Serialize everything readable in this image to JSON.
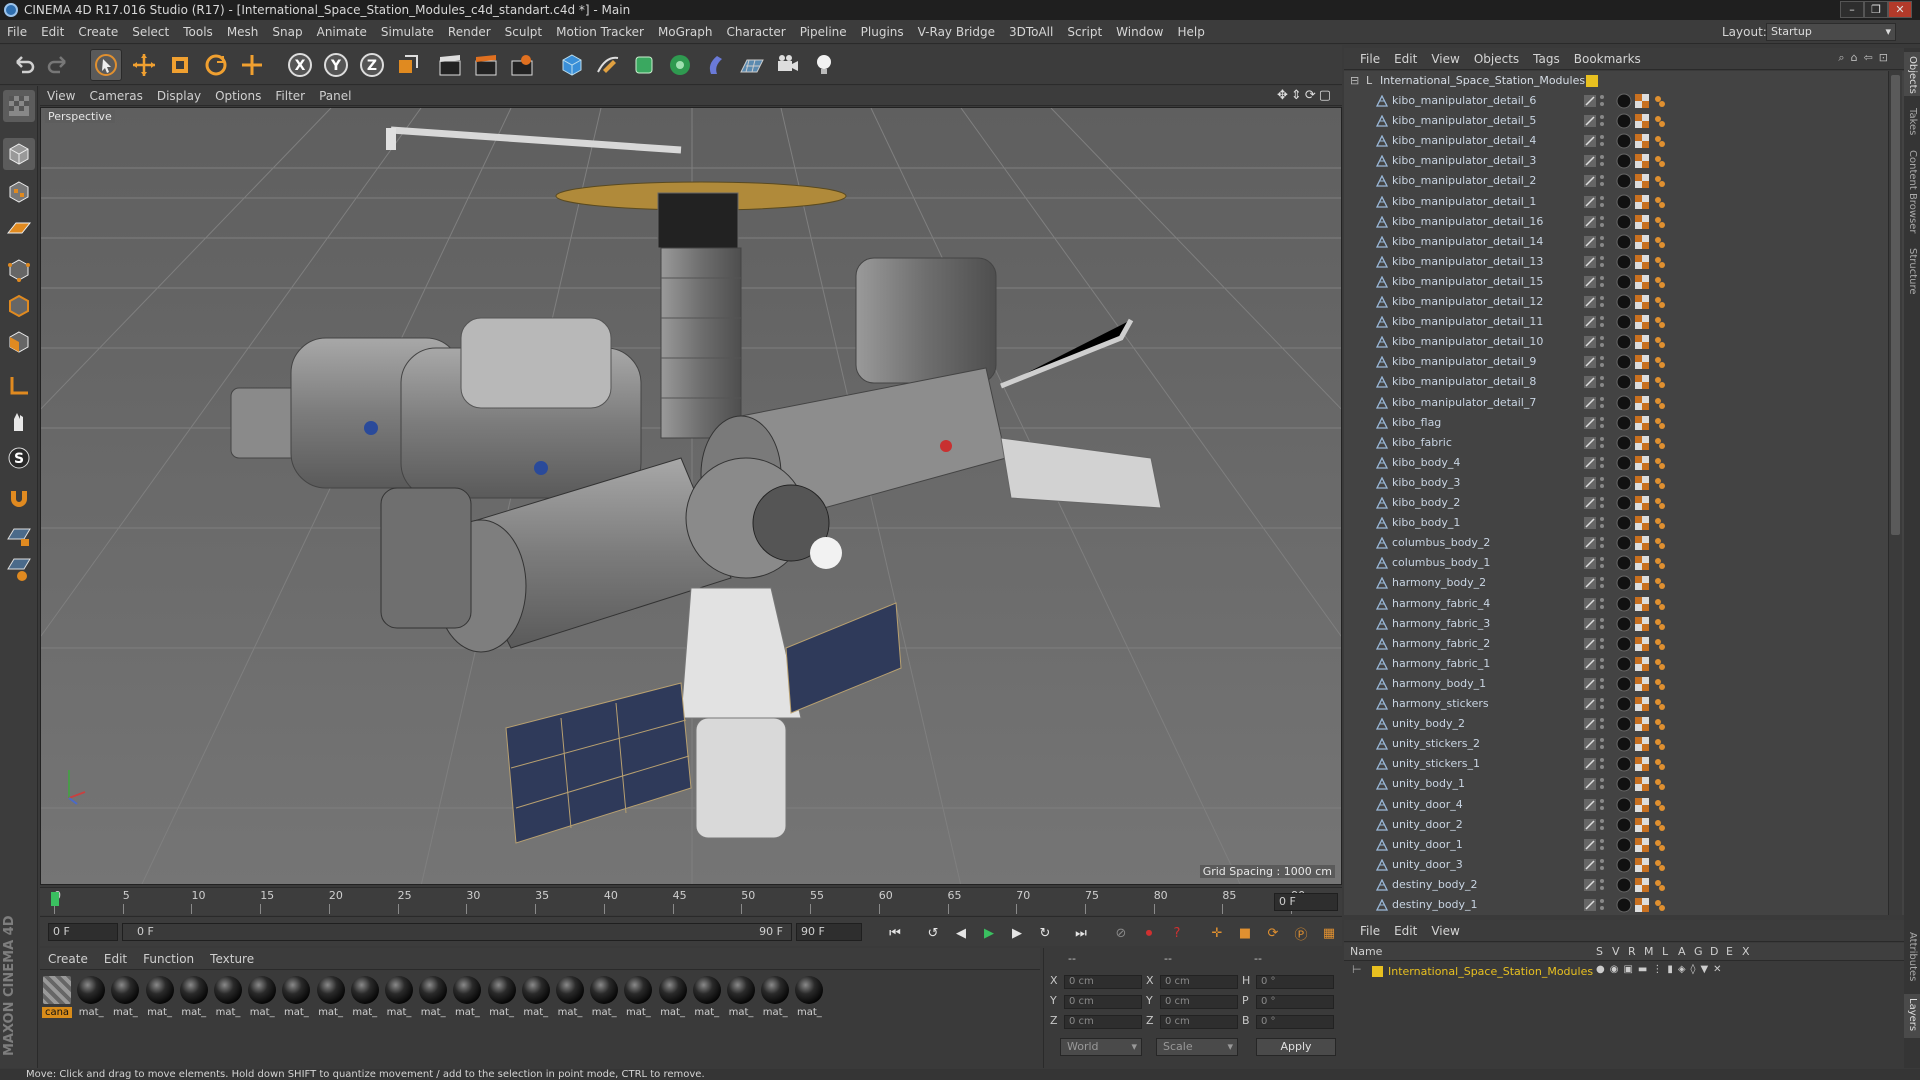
{
  "window": {
    "title": "CINEMA 4D R17.016 Studio (R17) - [International_Space_Station_Modules_c4d_standart.c4d *] - Main",
    "controls": [
      "–",
      "❐",
      "✕"
    ]
  },
  "menubar": {
    "items": [
      "File",
      "Edit",
      "Create",
      "Select",
      "Tools",
      "Mesh",
      "Snap",
      "Animate",
      "Simulate",
      "Render",
      "Sculpt",
      "Motion Tracker",
      "MoGraph",
      "Character",
      "Pipeline",
      "Plugins",
      "V-Ray Bridge",
      "3DToAll",
      "Script",
      "Window",
      "Help"
    ],
    "layout_label": "Layout:",
    "layout_value": "Startup"
  },
  "viewport": {
    "menu": [
      "View",
      "Cameras",
      "Display",
      "Options",
      "Filter",
      "Panel"
    ],
    "camera_label": "Perspective",
    "grid_spacing": "Grid Spacing : 1000 cm"
  },
  "timeline": {
    "ticks": [
      "0",
      "5",
      "10",
      "15",
      "20",
      "25",
      "30",
      "35",
      "40",
      "45",
      "50",
      "55",
      "60",
      "65",
      "70",
      "75",
      "80",
      "85",
      "90"
    ],
    "current_frame": "0 F",
    "start_field": "0 F",
    "range_start": "0 F",
    "range_end": "90 F",
    "end_field": "90 F"
  },
  "materials": {
    "menu": [
      "Create",
      "Edit",
      "Function",
      "Texture"
    ],
    "items": [
      "cana",
      "mat_",
      "mat_",
      "mat_",
      "mat_",
      "mat_",
      "mat_",
      "mat_",
      "mat_",
      "mat_",
      "mat_",
      "mat_",
      "mat_",
      "mat_",
      "mat_",
      "mat_",
      "mat_",
      "mat_",
      "mat_",
      "mat_",
      "mat_",
      "mat_",
      "mat_"
    ],
    "brand": "MAXON CINEMA 4D"
  },
  "coordinates": {
    "header_left": "--",
    "header_mid": "--",
    "header_right": "--",
    "rows": [
      {
        "a": "X",
        "av": "0 cm",
        "b": "X",
        "bv": "0 cm",
        "c": "H",
        "cv": "0 °"
      },
      {
        "a": "Y",
        "av": "0 cm",
        "b": "Y",
        "bv": "0 cm",
        "c": "P",
        "cv": "0 °"
      },
      {
        "a": "Z",
        "av": "0 cm",
        "b": "Z",
        "bv": "0 cm",
        "c": "B",
        "cv": "0 °"
      }
    ],
    "space": "World",
    "mode": "Scale",
    "apply": "Apply"
  },
  "object_manager": {
    "menu": [
      "File",
      "Edit",
      "View",
      "Objects",
      "Tags",
      "Bookmarks"
    ],
    "root": "International_Space_Station_Modules",
    "objects": [
      "kibo_manipulator_detail_6",
      "kibo_manipulator_detail_5",
      "kibo_manipulator_detail_4",
      "kibo_manipulator_detail_3",
      "kibo_manipulator_detail_2",
      "kibo_manipulator_detail_1",
      "kibo_manipulator_detail_16",
      "kibo_manipulator_detail_14",
      "kibo_manipulator_detail_13",
      "kibo_manipulator_detail_15",
      "kibo_manipulator_detail_12",
      "kibo_manipulator_detail_11",
      "kibo_manipulator_detail_10",
      "kibo_manipulator_detail_9",
      "kibo_manipulator_detail_8",
      "kibo_manipulator_detail_7",
      "kibo_flag",
      "kibo_fabric",
      "kibo_body_4",
      "kibo_body_3",
      "kibo_body_2",
      "kibo_body_1",
      "columbus_body_2",
      "columbus_body_1",
      "harmony_body_2",
      "harmony_fabric_4",
      "harmony_fabric_3",
      "harmony_fabric_2",
      "harmony_fabric_1",
      "harmony_body_1",
      "harmony_stickers",
      "unity_body_2",
      "unity_stickers_2",
      "unity_stickers_1",
      "unity_body_1",
      "unity_door_4",
      "unity_door_2",
      "unity_door_1",
      "unity_door_3",
      "destiny_body_2",
      "destiny_body_1"
    ]
  },
  "layer_manager": {
    "menu": [
      "File",
      "Edit",
      "View"
    ],
    "columns": [
      "Name",
      "S",
      "V",
      "R",
      "M",
      "L",
      "A",
      "G",
      "D",
      "E",
      "X"
    ],
    "layer_name": "International_Space_Station_Modules",
    "layer_color": "#e8c020"
  },
  "right_tabs": [
    "Objects",
    "Takes",
    "Content Browser",
    "Structure",
    "Attributes",
    "Layers"
  ],
  "status": "Move: Click and drag to move elements. Hold down SHIFT to quantize movement / add to the selection in point mode, CTRL to remove.",
  "colors": {
    "accent_orange": "#d98c1a",
    "object_name": "#c8d4e2",
    "layer_yellow": "#e8c020"
  }
}
